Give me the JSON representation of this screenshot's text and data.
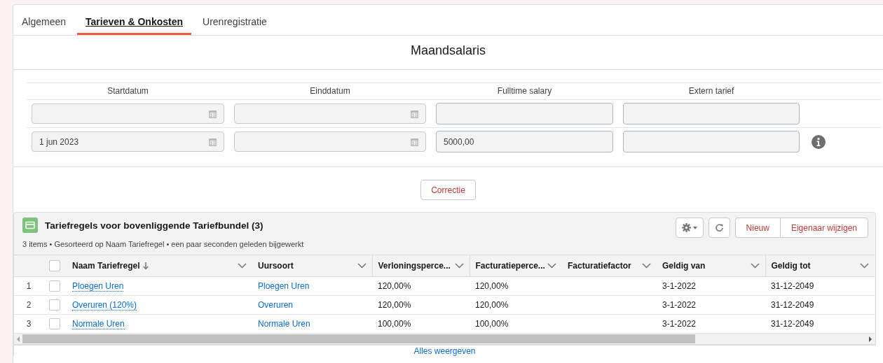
{
  "tabs": [
    {
      "label": "Algemeen",
      "selected": false
    },
    {
      "label": "Tarieven & Onkosten",
      "selected": true
    },
    {
      "label": "Urenregistratie",
      "selected": false
    }
  ],
  "section_title": "Maandsalaris",
  "salary_grid": {
    "columns": [
      "Startdatum",
      "Einddatum",
      "Fulltime salary",
      "Extern tarief"
    ],
    "rows": [
      {
        "info": false,
        "fields": [
          {
            "kind": "date"
          },
          {
            "kind": "date"
          },
          {
            "kind": "number"
          },
          {
            "kind": "number"
          }
        ]
      },
      {
        "info": true,
        "fields": [
          {
            "kind": "date",
            "value": "1 jun 2023"
          },
          {
            "kind": "date"
          },
          {
            "kind": "number",
            "value": "5000,00"
          },
          {
            "kind": "number"
          }
        ]
      }
    ]
  },
  "correction_button": "Correctie",
  "related_list": {
    "title": "Tariefregels voor bovenliggende Tariefbundel (3)",
    "subtitle": "3 items • Gesorteerd op Naam Tariefregel • een paar seconden geleden bijgewerkt",
    "buttons": [
      "Nieuw",
      "Eigenaar wijzigen"
    ],
    "select_all_checked": false,
    "columns": [
      {
        "label": "Naam Tariefregel",
        "sorted": true
      },
      {
        "label": "Uursoort",
        "sorted": false
      },
      {
        "label": "Verloningsperce...",
        "sorted": false
      },
      {
        "label": "Facturatieperce...",
        "sorted": false
      },
      {
        "label": "Facturatiefactor",
        "sorted": false
      },
      {
        "label": "Geldig van",
        "sorted": false
      },
      {
        "label": "Geldig tot",
        "sorted": false
      }
    ],
    "rows": [
      {
        "number": "1",
        "checked": false,
        "cells": [
          {
            "kind": "record_link",
            "text": "Ploegen Uren"
          },
          {
            "kind": "link",
            "text": "Ploegen Uren"
          },
          {
            "kind": "text",
            "text": "120,00%"
          },
          {
            "kind": "text",
            "text": "120,00%"
          },
          {
            "kind": "text"
          },
          {
            "kind": "text",
            "text": "3-1-2022"
          },
          {
            "kind": "text",
            "text": "31-12-2049"
          }
        ]
      },
      {
        "number": "2",
        "checked": false,
        "cells": [
          {
            "kind": "record_link",
            "text": "Overuren (120%)"
          },
          {
            "kind": "link",
            "text": "Overuren"
          },
          {
            "kind": "text",
            "text": "120,00%"
          },
          {
            "kind": "text",
            "text": "120,00%"
          },
          {
            "kind": "text"
          },
          {
            "kind": "text",
            "text": "3-1-2022"
          },
          {
            "kind": "text",
            "text": "31-12-2049"
          }
        ]
      },
      {
        "number": "3",
        "checked": false,
        "cells": [
          {
            "kind": "record_link",
            "text": "Normale Uren"
          },
          {
            "kind": "link",
            "text": "Normale Uren"
          },
          {
            "kind": "text",
            "text": "100,00%"
          },
          {
            "kind": "text",
            "text": "100,00%"
          },
          {
            "kind": "text"
          },
          {
            "kind": "text",
            "text": "3-1-2022"
          },
          {
            "kind": "text",
            "text": "31-12-2049"
          }
        ]
      }
    ],
    "footer_link": "Alles weergeven"
  }
}
